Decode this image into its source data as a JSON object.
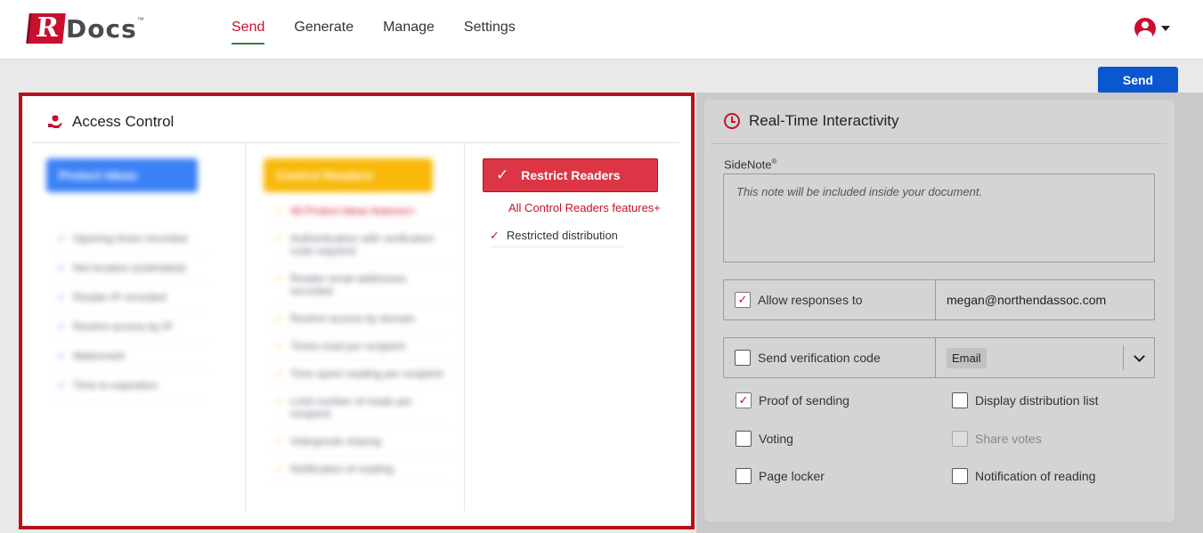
{
  "header": {
    "logo_r": "R",
    "logo_rest": "Docs",
    "logo_tm": "™",
    "nav": [
      {
        "label": "Send",
        "active": true
      },
      {
        "label": "Generate",
        "active": false
      },
      {
        "label": "Manage",
        "active": false
      },
      {
        "label": "Settings",
        "active": false
      }
    ]
  },
  "send_button": "Send",
  "access_control": {
    "title": "Access Control",
    "tiers": {
      "protect": {
        "label": "Protect Ideas",
        "features": [
          "Opening times recorded",
          "Net location (estimated)",
          "Reader IP recorded",
          "Restrict access by IP",
          "Watermark",
          "Time to expiration"
        ]
      },
      "control": {
        "label": "Control Readers",
        "features": [
          "All Protect Ideas features+",
          "Authentication with verification code required",
          "Reader email addresses recorded",
          "Restrict access by domain",
          "Times read per recipient",
          "Time spent reading per recipient",
          "Limit number of reads per recipient",
          "Voting/vote sharing",
          "Notification of reading"
        ]
      },
      "restrict": {
        "label": "Restrict Readers",
        "check": "✓",
        "features_head": "All Control Readers features+",
        "features": [
          "Restricted distribution"
        ]
      }
    }
  },
  "realtime": {
    "title": "Real-Time Interactivity",
    "sidenote_label": "SideNote",
    "sidenote_sup": "®",
    "sidenote_placeholder": "This note will be included inside your document.",
    "allow_responses": {
      "label": "Allow responses to",
      "checked": true,
      "value": "megan@northendassoc.com"
    },
    "verification": {
      "label": "Send verification code",
      "checked": false,
      "selected": "Email"
    },
    "options": {
      "proof_of_sending": {
        "label": "Proof of sending",
        "checked": true
      },
      "display_distribution": {
        "label": "Display distribution list",
        "checked": false
      },
      "voting": {
        "label": "Voting",
        "checked": false
      },
      "share_votes": {
        "label": "Share votes",
        "checked": false,
        "disabled": true
      },
      "page_locker": {
        "label": "Page locker",
        "checked": false
      },
      "notification_reading": {
        "label": "Notification of reading",
        "checked": false
      }
    },
    "check_glyph": "✓"
  },
  "colors": {
    "brand_red": "#c8102e",
    "send_blue": "#0b57d0",
    "protect_blue": "#3b82f6",
    "control_yellow": "#f9b90b",
    "restrict_red": "#dc3545"
  }
}
